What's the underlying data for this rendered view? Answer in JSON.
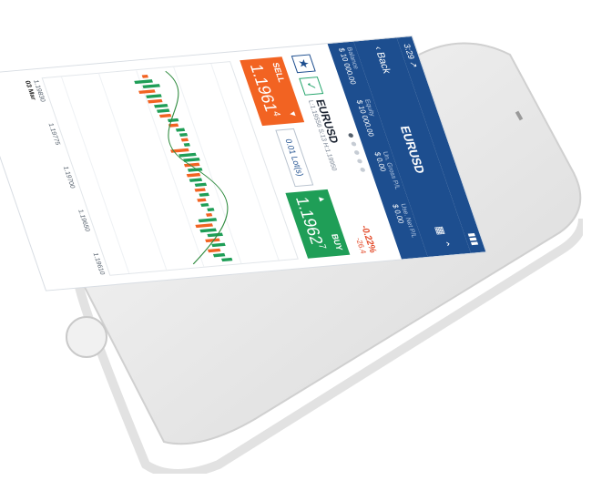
{
  "status_bar": {
    "time": "3:29 ↗"
  },
  "nav": {
    "back_label": "Back",
    "title": "EURUSD"
  },
  "summary": [
    {
      "label": "Balance",
      "value": "$ 10 000.00"
    },
    {
      "label": "Equity",
      "value": "$ 10 000.00"
    },
    {
      "label": "Un. Gross P/L",
      "value": "$ 0.00"
    },
    {
      "label": "Use. Net P/L",
      "value": "$ 0.00"
    }
  ],
  "instrument": {
    "symbol": "EURUSD",
    "hl": "L:1.19556 S:13 H:1.19950",
    "change_pct": "-0.22%",
    "change_pts": "-26.4"
  },
  "trade": {
    "sell_label": "SELL",
    "sell_price": "1.1961",
    "sell_price_small": "4",
    "lots": "0.01 Lot(s)",
    "buy_label": "BUY",
    "buy_price": "1.1962",
    "buy_price_small": "7"
  },
  "chart_axis": [
    "1.19830",
    "1.19775",
    "1.19700",
    "1.19650",
    "1.19610"
  ],
  "chart_time_label": "03 Mar",
  "colors": {
    "brand": "#1d4e8f",
    "sell": "#f26322",
    "buy": "#1f9e57",
    "down": "#e34b2a"
  }
}
